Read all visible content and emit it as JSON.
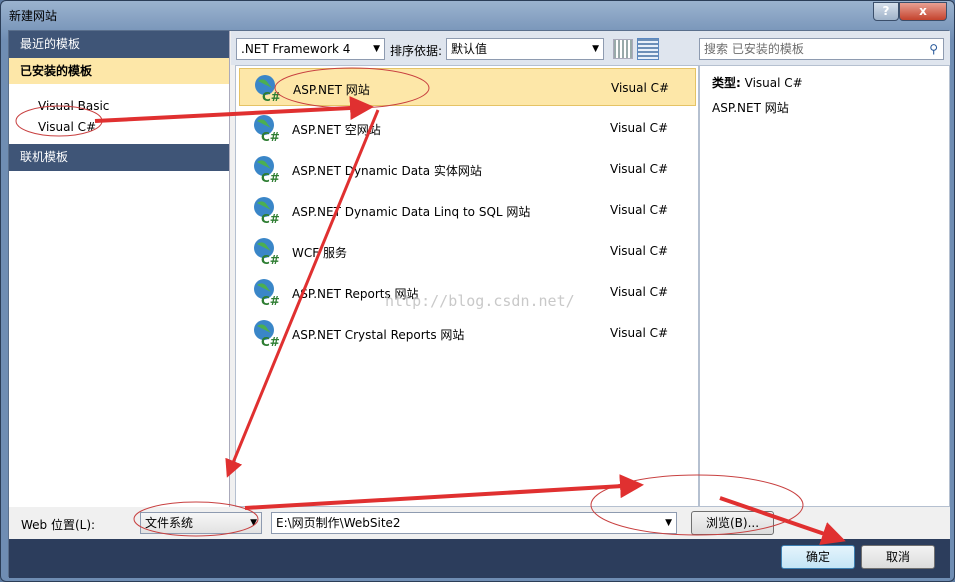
{
  "window": {
    "title": "新建网站",
    "help_label": "?",
    "close_label": "x"
  },
  "sidebar": {
    "recent": "最近的模板",
    "installed": "已安装的模板",
    "items": [
      {
        "label": "Visual Basic"
      },
      {
        "label": "Visual C#"
      }
    ],
    "online": "联机模板"
  },
  "toolbar": {
    "framework": ".NET Framework 4",
    "sort_label": "排序依据:",
    "sort_value": "默认值",
    "search_placeholder": "搜索 已安装的模板"
  },
  "templates": [
    {
      "name": "ASP.NET 网站",
      "lang": "Visual C#",
      "selected": true
    },
    {
      "name": "ASP.NET 空网站",
      "lang": "Visual C#"
    },
    {
      "name": "ASP.NET Dynamic Data 实体网站",
      "lang": "Visual C#"
    },
    {
      "name": "ASP.NET Dynamic Data Linq to SQL 网站",
      "lang": "Visual C#"
    },
    {
      "name": "WCF 服务",
      "lang": "Visual C#"
    },
    {
      "name": "ASP.NET Reports 网站",
      "lang": "Visual C#"
    },
    {
      "name": "ASP.NET Crystal Reports 网站",
      "lang": "Visual C#"
    }
  ],
  "details": {
    "type_label": "类型:",
    "type_value": "Visual C#",
    "description": "ASP.NET 网站"
  },
  "location": {
    "label": "Web 位置(L):",
    "type": "文件系统",
    "path": "E:\\网页制作\\WebSite2",
    "browse": "浏览(B)..."
  },
  "footer": {
    "ok": "确定",
    "cancel": "取消"
  },
  "watermark": "http://blog.csdn.net/",
  "colors": {
    "annotation": "#e03030",
    "selection": "#fde7a8",
    "header": "#3f5577"
  }
}
